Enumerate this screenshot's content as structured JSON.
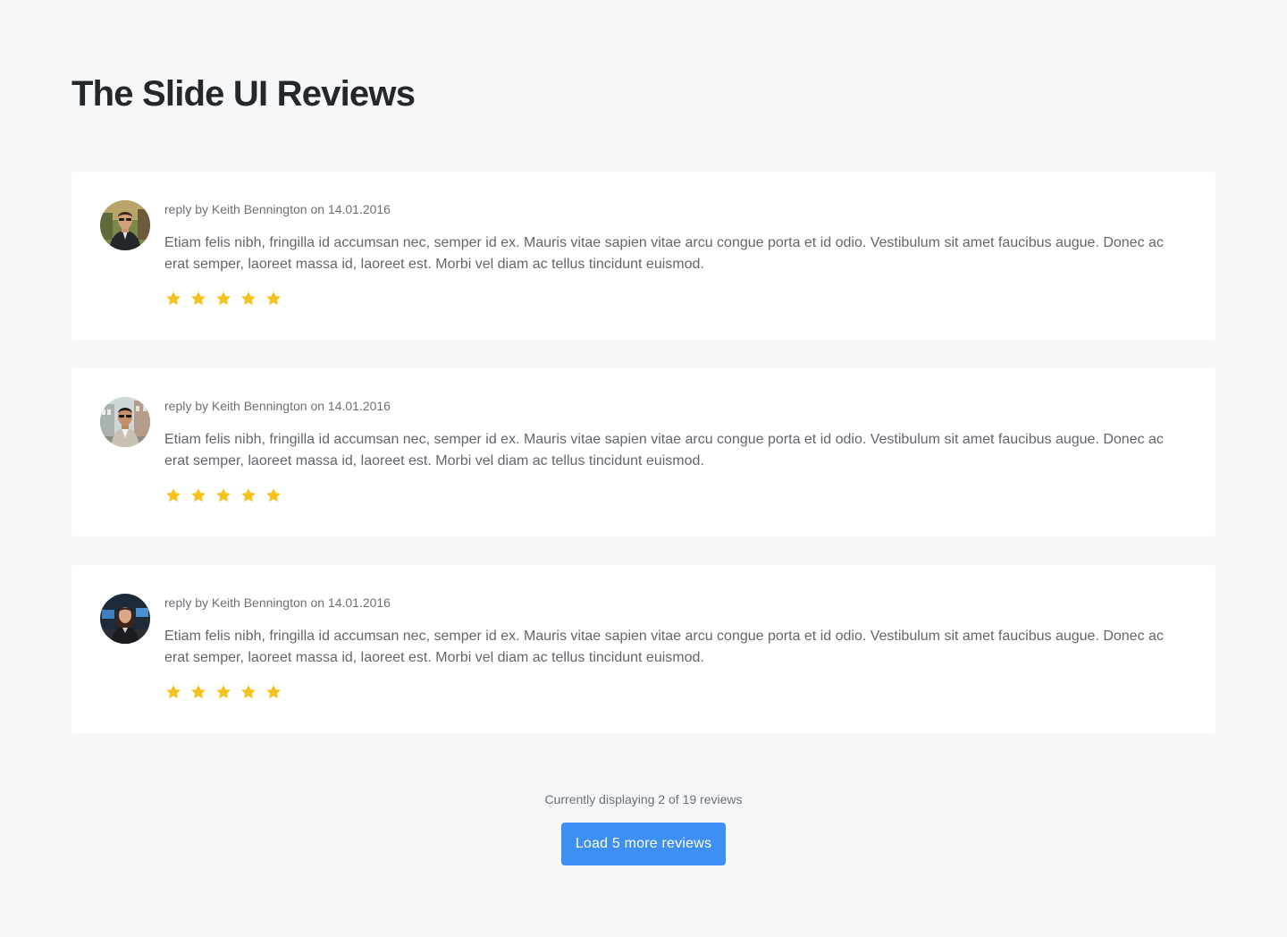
{
  "page": {
    "title": "The Slide UI Reviews"
  },
  "reviews": [
    {
      "meta": "reply by Keith Bennington on 14.01.2016",
      "text": "Etiam felis nibh, fringilla id accumsan nec, semper id ex. Mauris vitae sapien vitae arcu congue porta et id odio. Vestibulum sit amet faucibus augue. Donec ac erat semper, laoreet massa id, laoreet est. Morbi vel diam ac tellus tincidunt euismod.",
      "rating": 5,
      "avatar": "man-in-suit-outdoors-photo"
    },
    {
      "meta": "reply by Keith Bennington on 14.01.2016",
      "text": "Etiam felis nibh, fringilla id accumsan nec, semper id ex. Mauris vitae sapien vitae arcu congue porta et id odio. Vestibulum sit amet faucibus augue. Donec ac erat semper, laoreet massa id, laoreet est. Morbi vel diam ac tellus tincidunt euismod.",
      "rating": 5,
      "avatar": "man-with-sunglasses-city-photo"
    },
    {
      "meta": "reply by Keith Bennington on 14.01.2016",
      "text": "Etiam felis nibh, fringilla id accumsan nec, semper id ex. Mauris vitae sapien vitae arcu congue porta et id odio. Vestibulum sit amet faucibus augue. Donec ac erat semper, laoreet massa id, laoreet est. Morbi vel diam ac tellus tincidunt euismod.",
      "rating": 5,
      "avatar": "woman-in-office-photo"
    }
  ],
  "footer": {
    "display_count": "Currently displaying 2 of 19 reviews",
    "load_more_label": "Load 5 more reviews"
  },
  "colors": {
    "background": "#f6f7f9",
    "card": "#ffffff",
    "title": "#25282b",
    "text": "#62676d",
    "star": "#f6c31c",
    "button": "#3d8ff4"
  }
}
